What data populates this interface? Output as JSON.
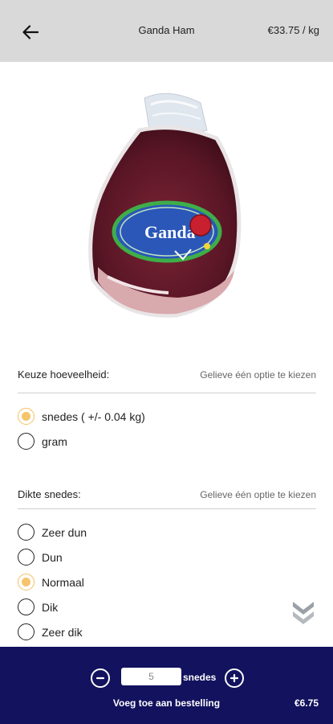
{
  "header": {
    "back_icon": "arrow-left-icon",
    "title": "Ganda Ham",
    "price": "€33.75 / kg"
  },
  "product": {
    "image_label": "Ganda"
  },
  "quantity_section": {
    "label": "Keuze hoeveelheid:",
    "hint": "Gelieve één optie te kiezen",
    "options": [
      {
        "label": "snedes ( +/- 0.04 kg)",
        "selected": true
      },
      {
        "label": "gram",
        "selected": false
      }
    ]
  },
  "thickness_section": {
    "label": "Dikte snedes:",
    "hint": "Gelieve één optie te kiezen",
    "options": [
      {
        "label": "Zeer dun",
        "selected": false
      },
      {
        "label": "Dun",
        "selected": false
      },
      {
        "label": "Normaal",
        "selected": true
      },
      {
        "label": "Dik",
        "selected": false
      },
      {
        "label": "Zeer dik",
        "selected": false
      }
    ]
  },
  "scroll_hint_icon": "double-chevron-down-icon",
  "bottom_bar": {
    "quantity_value": "5",
    "unit": "snedes",
    "add_label": "Voeg toe aan bestelling",
    "total": "€6.75",
    "minus_icon": "minus-circle-icon",
    "plus_icon": "plus-circle-icon"
  },
  "colors": {
    "header_bg": "#d9d9d9",
    "bottom_bar_bg": "#13125e",
    "radio_selected": "#f6c46a"
  }
}
